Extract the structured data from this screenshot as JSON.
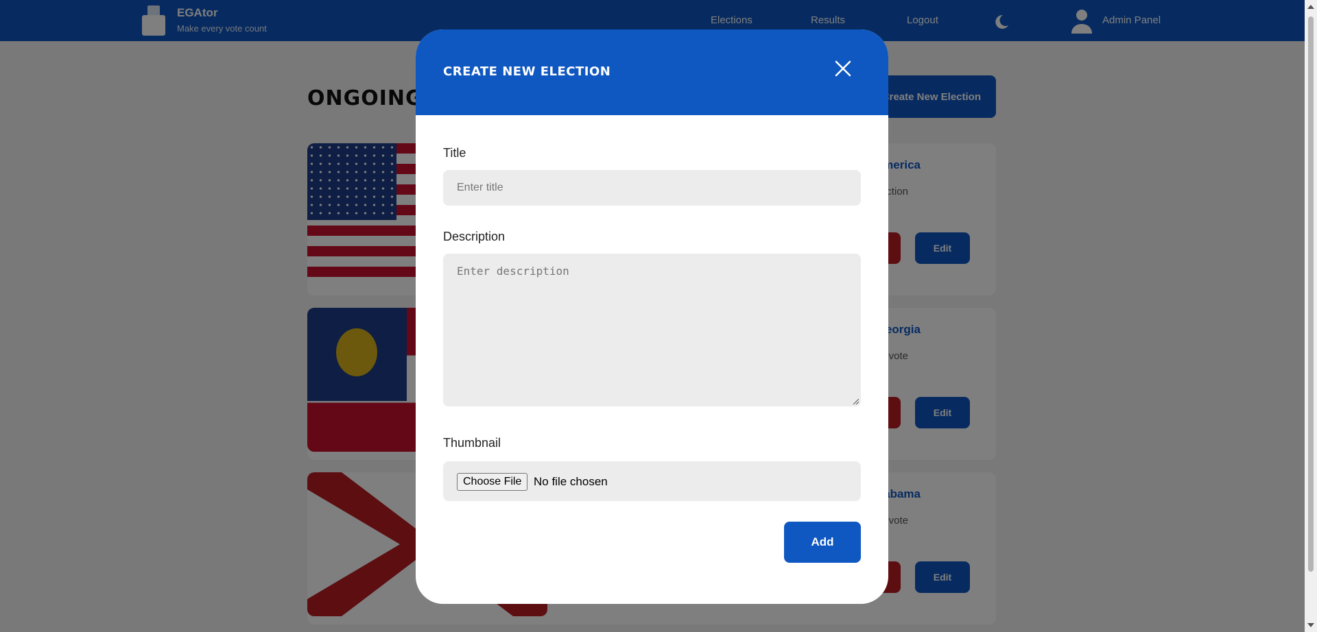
{
  "navbar": {
    "brand": "EGAtor",
    "tagline": "Make every vote count",
    "links": [
      "Elections",
      "Results",
      "Logout"
    ],
    "user": "Admin Panel"
  },
  "page": {
    "title": "ONGOING ELECTIONS",
    "create_button": "Create New Election"
  },
  "cards": [
    {
      "title": "United States of America",
      "description": "The US election",
      "edit_label": "Edit",
      "flag": "us-flag"
    },
    {
      "title": "Georgia",
      "description": "The Georgia state vote",
      "edit_label": "Edit",
      "flag": "georgia-flag"
    },
    {
      "title": "Alabama",
      "description": "The Alabama vote",
      "edit_label": "Edit",
      "flag": "alabama-flag"
    }
  ],
  "modal": {
    "title": "CREATE NEW ELECTION",
    "close_icon": "close-icon",
    "title_label": "Title",
    "title_placeholder": "Enter title",
    "description_label": "Description",
    "description_placeholder": "Enter description",
    "thumbnail_label": "Thumbnail",
    "file_button": "Choose File",
    "file_status": "No file chosen",
    "add_button": "Add"
  },
  "colors": {
    "primary": "#0f57c1",
    "danger": "#b81d23",
    "field_bg": "#ececec"
  }
}
